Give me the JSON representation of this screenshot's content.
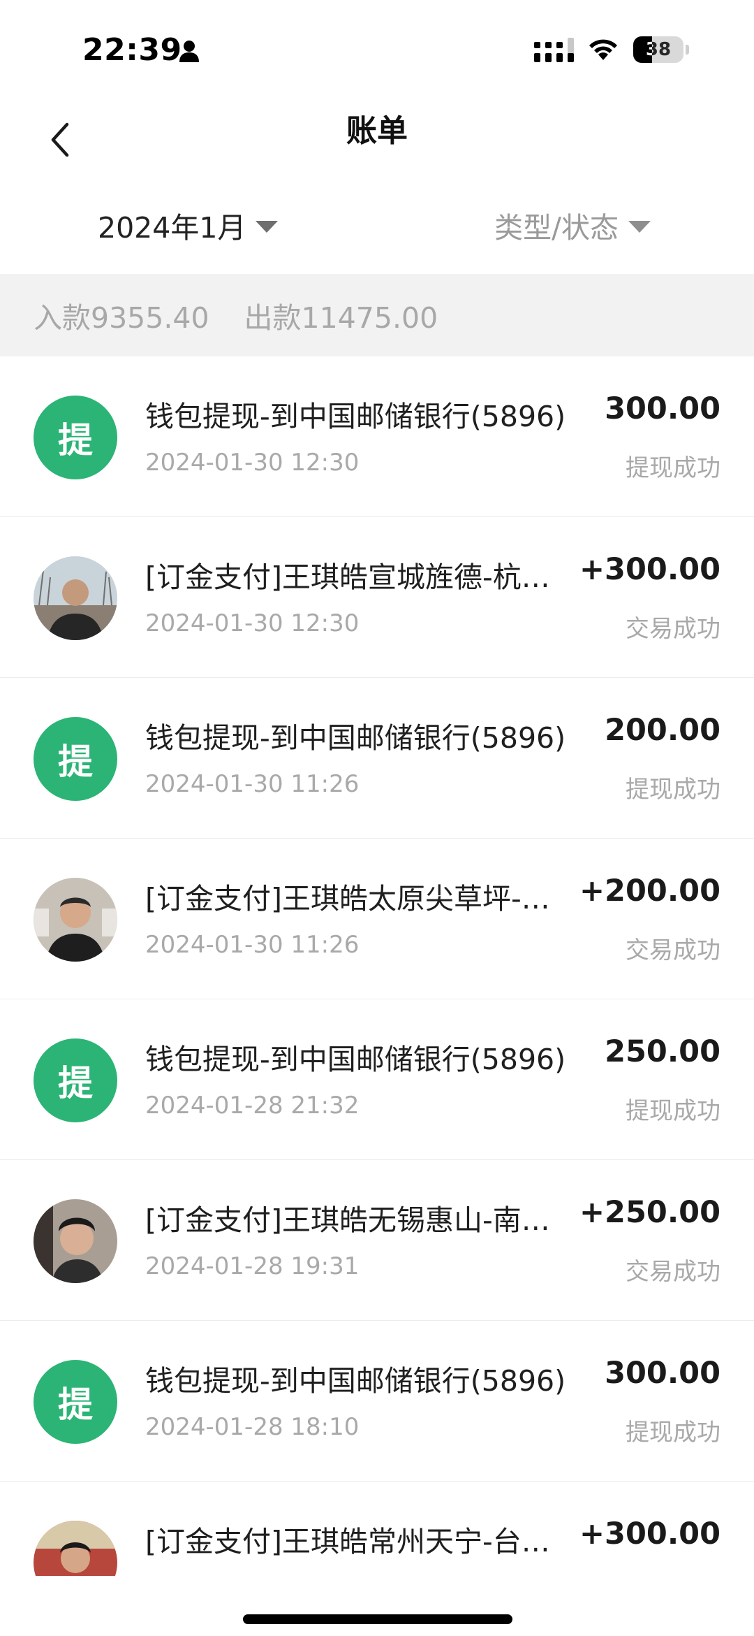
{
  "status_bar": {
    "time": "22:39",
    "battery_level": "38",
    "icons": [
      "person-icon",
      "cellular-signal-icon",
      "wifi-icon",
      "battery-icon"
    ]
  },
  "header": {
    "title": "账单",
    "back_icon": "chevron-left-icon"
  },
  "filters": {
    "month": "2024年1月",
    "type_status": "类型/状态"
  },
  "summary": {
    "income": "入款9355.40",
    "expense": "出款11475.00"
  },
  "transactions": [
    {
      "avatar": "提",
      "title": "钱包提现-到中国邮储银行(5896)",
      "amount": "300.00",
      "date": "2024-01-30 12:30",
      "status": "提现成功"
    },
    {
      "avatar": "photo",
      "title": "[订金支付]王琪皓宣城旌德-杭…",
      "amount": "+300.00",
      "date": "2024-01-30 12:30",
      "status": "交易成功"
    },
    {
      "avatar": "提",
      "title": "钱包提现-到中国邮储银行(5896)",
      "amount": "200.00",
      "date": "2024-01-30 11:26",
      "status": "提现成功"
    },
    {
      "avatar": "photo",
      "title": "[订金支付]王琪皓太原尖草坪-…",
      "amount": "+200.00",
      "date": "2024-01-30 11:26",
      "status": "交易成功"
    },
    {
      "avatar": "提",
      "title": "钱包提现-到中国邮储银行(5896)",
      "amount": "250.00",
      "date": "2024-01-28 21:32",
      "status": "提现成功"
    },
    {
      "avatar": "photo",
      "title": "[订金支付]王琪皓无锡惠山-南…",
      "amount": "+250.00",
      "date": "2024-01-28 19:31",
      "status": "交易成功"
    },
    {
      "avatar": "提",
      "title": "钱包提现-到中国邮储银行(5896)",
      "amount": "300.00",
      "date": "2024-01-28 18:10",
      "status": "提现成功"
    },
    {
      "avatar": "photo",
      "title": "[订金支付]王琪皓常州天宁-台…",
      "amount": "+300.00",
      "date": "",
      "status": ""
    }
  ],
  "colors": {
    "withdraw_badge": "#2bb475",
    "summary_band": "#f2f2f2",
    "secondary_text": "#a9a9a9"
  }
}
